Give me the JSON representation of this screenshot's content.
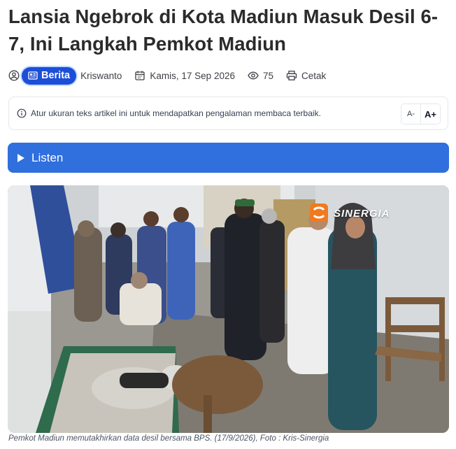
{
  "article": {
    "title": "Lansia Ngebrok di Kota Madiun Masuk Desil 6-7, Ini Langkah Pemkot Madiun",
    "category": "Berita",
    "author": "Kriswanto",
    "date": "Kamis, 17 Sep 2026",
    "views": "75",
    "print_label": "Cetak"
  },
  "notice": {
    "text": "Atur ukuran teks artikel ini untuk mendapatkan pengalaman membaca terbaik.",
    "decrease_label": "A-",
    "increase_label": "A+"
  },
  "listen": {
    "label": "Listen"
  },
  "photo": {
    "watermark": "SINERGIA",
    "caption": "Pemkot Madiun memutakhirkan data desil bersama BPS. (17/9/2026), Foto : Kris-Sinergia"
  },
  "colors": {
    "accent": "#2f6fde",
    "badge": "#1d4ed8"
  }
}
